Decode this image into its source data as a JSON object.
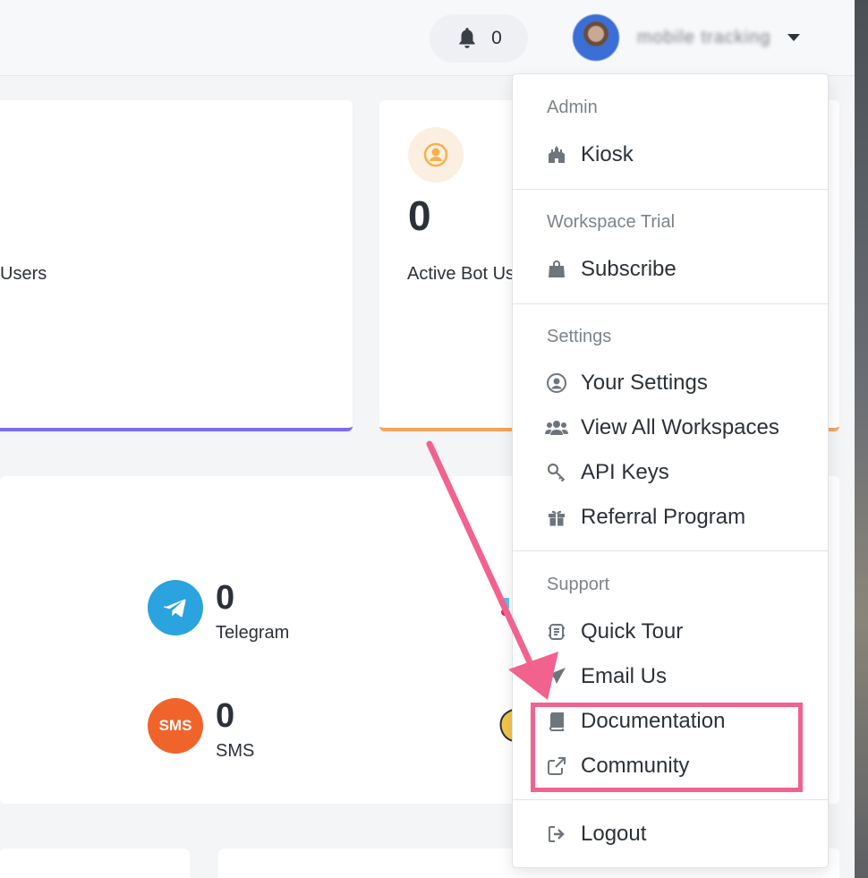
{
  "header": {
    "notifications_count": "0",
    "username": "mobile tracking"
  },
  "cards": {
    "users_label": "Users",
    "active_bot_value": "0",
    "active_bot_label": "Active Bot Us"
  },
  "channels": [
    {
      "name": "Telegram",
      "count": "0",
      "icon": "telegram-icon"
    },
    {
      "name": "SMS",
      "count": "0",
      "icon": "sms-icon",
      "icon_text": "SMS"
    }
  ],
  "dropdown": {
    "sections": [
      {
        "title": "Admin",
        "items": [
          {
            "label": "Kiosk",
            "icon": "kiosk-icon"
          }
        ]
      },
      {
        "title": "Workspace Trial",
        "items": [
          {
            "label": "Subscribe",
            "icon": "shopping-bag-icon"
          }
        ]
      },
      {
        "title": "Settings",
        "items": [
          {
            "label": "Your Settings",
            "icon": "user-circle-icon"
          },
          {
            "label": "View All Workspaces",
            "icon": "users-icon"
          },
          {
            "label": "API Keys",
            "icon": "key-icon"
          },
          {
            "label": "Referral Program",
            "icon": "gift-icon"
          }
        ]
      },
      {
        "title": "Support",
        "items": [
          {
            "label": "Quick Tour",
            "icon": "tour-icon"
          },
          {
            "label": "Email Us",
            "icon": "paper-plane-icon"
          },
          {
            "label": "Documentation",
            "icon": "book-icon"
          },
          {
            "label": "Community",
            "icon": "external-link-icon"
          }
        ]
      }
    ],
    "logout_label": "Logout"
  },
  "colors": {
    "accent_purple": "#7b6cf0",
    "accent_orange": "#f2a65a",
    "highlight_pink": "#f2628e",
    "telegram_blue": "#2aa3df",
    "sms_orange": "#f0642c"
  }
}
